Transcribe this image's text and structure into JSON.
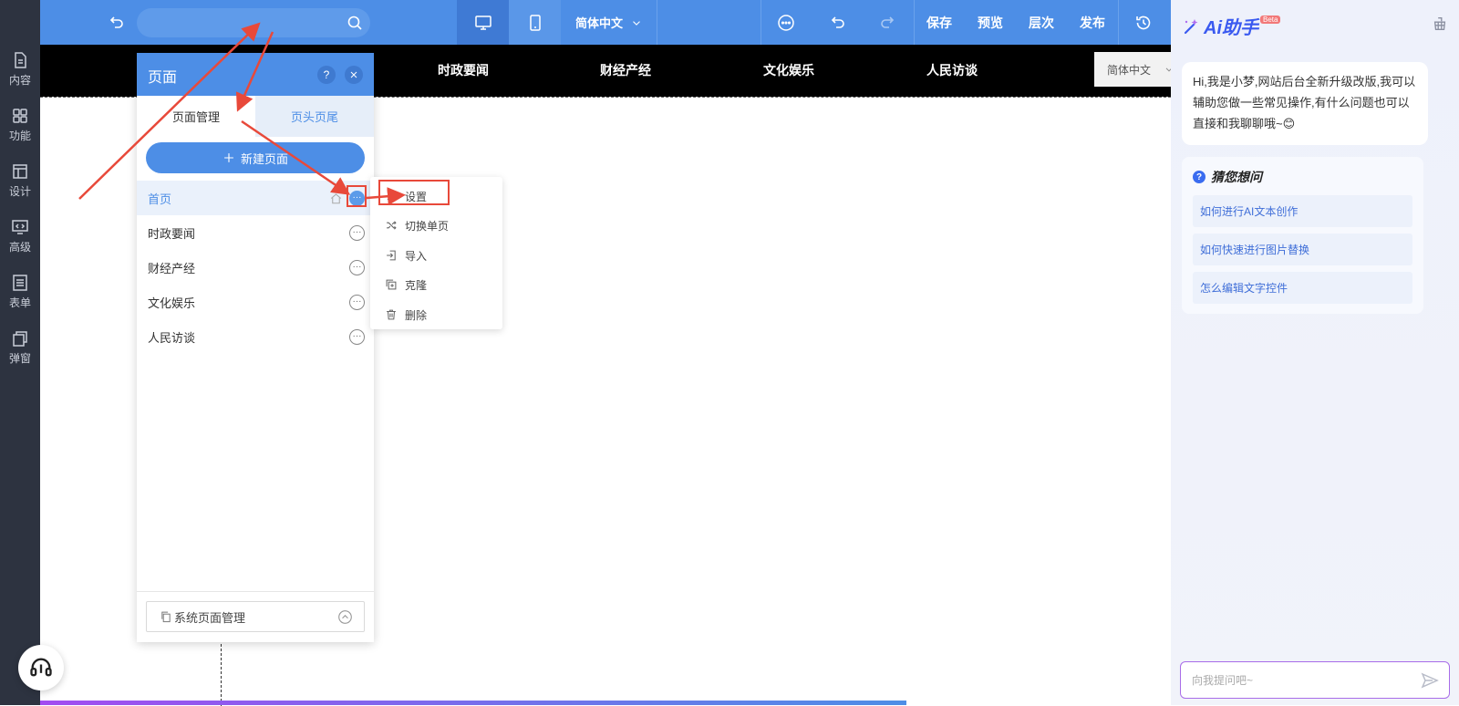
{
  "sidebar": {
    "items": [
      {
        "label": "内容",
        "icon": "document-icon"
      },
      {
        "label": "功能",
        "icon": "grid-icon"
      },
      {
        "label": "设计",
        "icon": "layout-icon"
      },
      {
        "label": "高级",
        "icon": "code-monitor-icon"
      },
      {
        "label": "表单",
        "icon": "form-icon"
      },
      {
        "label": "弹窗",
        "icon": "popup-icon"
      }
    ]
  },
  "toolbar": {
    "language": "简体中文",
    "save_label": "保存",
    "preview_label": "预览",
    "layers_label": "层次",
    "publish_label": "发布"
  },
  "site_nav": {
    "items": [
      "时政要闻",
      "财经产经",
      "文化娱乐",
      "人民访谈"
    ],
    "language": "简体中文"
  },
  "page_panel": {
    "title": "页面",
    "help": "?",
    "tabs": [
      "页面管理",
      "页头页尾"
    ],
    "active_tab": 0,
    "new_page_label": "新建页面",
    "pages": [
      {
        "name": "首页",
        "home": true,
        "selected": true
      },
      {
        "name": "时政要闻"
      },
      {
        "name": "财经产经"
      },
      {
        "name": "文化娱乐"
      },
      {
        "name": "人民访谈"
      }
    ],
    "system_pages_label": "系统页面管理"
  },
  "context_menu": {
    "items": [
      {
        "label": "设置",
        "icon": "gear-icon"
      },
      {
        "label": "切换单页",
        "icon": "shuffle-icon"
      },
      {
        "label": "导入",
        "icon": "import-icon"
      },
      {
        "label": "克隆",
        "icon": "clone-icon"
      },
      {
        "label": "删除",
        "icon": "trash-icon"
      }
    ]
  },
  "ai_panel": {
    "title": "Ai助手",
    "badge": "Beta",
    "greeting": "Hi,我是小梦,网站后台全新升级改版,我可以辅助您做一些常见操作,有什么问题也可以直接和我聊聊哦~😊",
    "guess_title": "猜您想问",
    "guess_items": [
      "如何进行AI文本创作",
      "如何快速进行图片替换",
      "怎么编辑文字控件"
    ],
    "input_placeholder": "向我提问吧~"
  },
  "colors": {
    "toolbar_blue": "#4d8ee6",
    "sidebar_dark": "#2d3340",
    "annotation_red": "#e8493a",
    "ai_accent": "#3a5af0"
  }
}
